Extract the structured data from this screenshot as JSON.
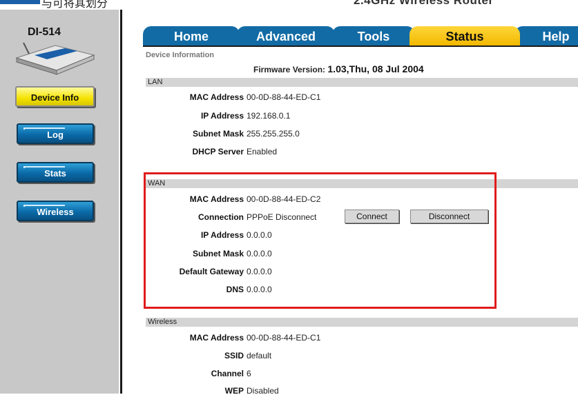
{
  "banner": {
    "cjk_text": "与可将其划分",
    "router_title": "2.4GHz Wireless Router"
  },
  "sidebar": {
    "model": "DI-514",
    "nav": [
      {
        "label": "Device Info",
        "active": true
      },
      {
        "label": "Log",
        "active": false
      },
      {
        "label": "Stats",
        "active": false
      },
      {
        "label": "Wireless",
        "active": false
      }
    ]
  },
  "tabs": [
    {
      "label": "Home",
      "active": false
    },
    {
      "label": "Advanced",
      "active": false
    },
    {
      "label": "Tools",
      "active": false
    },
    {
      "label": "Status",
      "active": true
    },
    {
      "label": "Help",
      "active": false
    }
  ],
  "device_info": {
    "title": "Device Information",
    "firmware_label": "Firmware Version:",
    "firmware_value": "1.03,Thu, 08 Jul 2004"
  },
  "lan": {
    "title": "LAN",
    "rows": [
      {
        "label": "MAC Address",
        "value": "00-0D-88-44-ED-C1"
      },
      {
        "label": "IP Address",
        "value": "192.168.0.1"
      },
      {
        "label": "Subnet Mask",
        "value": "255.255.255.0"
      },
      {
        "label": "DHCP Server",
        "value": "Enabled"
      }
    ]
  },
  "wan": {
    "title": "WAN",
    "rows": [
      {
        "label": "MAC Address",
        "value": "00-0D-88-44-ED-C2"
      },
      {
        "label": "Connection",
        "value": "PPPoE Disconnect"
      },
      {
        "label": "IP Address",
        "value": "0.0.0.0"
      },
      {
        "label": "Subnet Mask",
        "value": "0.0.0.0"
      },
      {
        "label": "Default Gateway",
        "value": "0.0.0.0"
      },
      {
        "label": "DNS",
        "value": "0.0.0.0"
      }
    ],
    "connect_label": "Connect",
    "disconnect_label": "Disconnect"
  },
  "wireless": {
    "title": "Wireless",
    "rows": [
      {
        "label": "MAC Address",
        "value": "00-0D-88-44-ED-C1"
      },
      {
        "label": "SSID",
        "value": "default"
      },
      {
        "label": "Channel",
        "value": "6"
      },
      {
        "label": "WEP",
        "value": "Disabled"
      }
    ]
  },
  "colors": {
    "tab_blue": "#126ba5",
    "tab_active": "#f2b800",
    "nav_active": "#f4e300",
    "highlight_box": "#e01b1b",
    "section_bar": "#d4d4d4",
    "sidebar_bg": "#c8c8c8"
  }
}
